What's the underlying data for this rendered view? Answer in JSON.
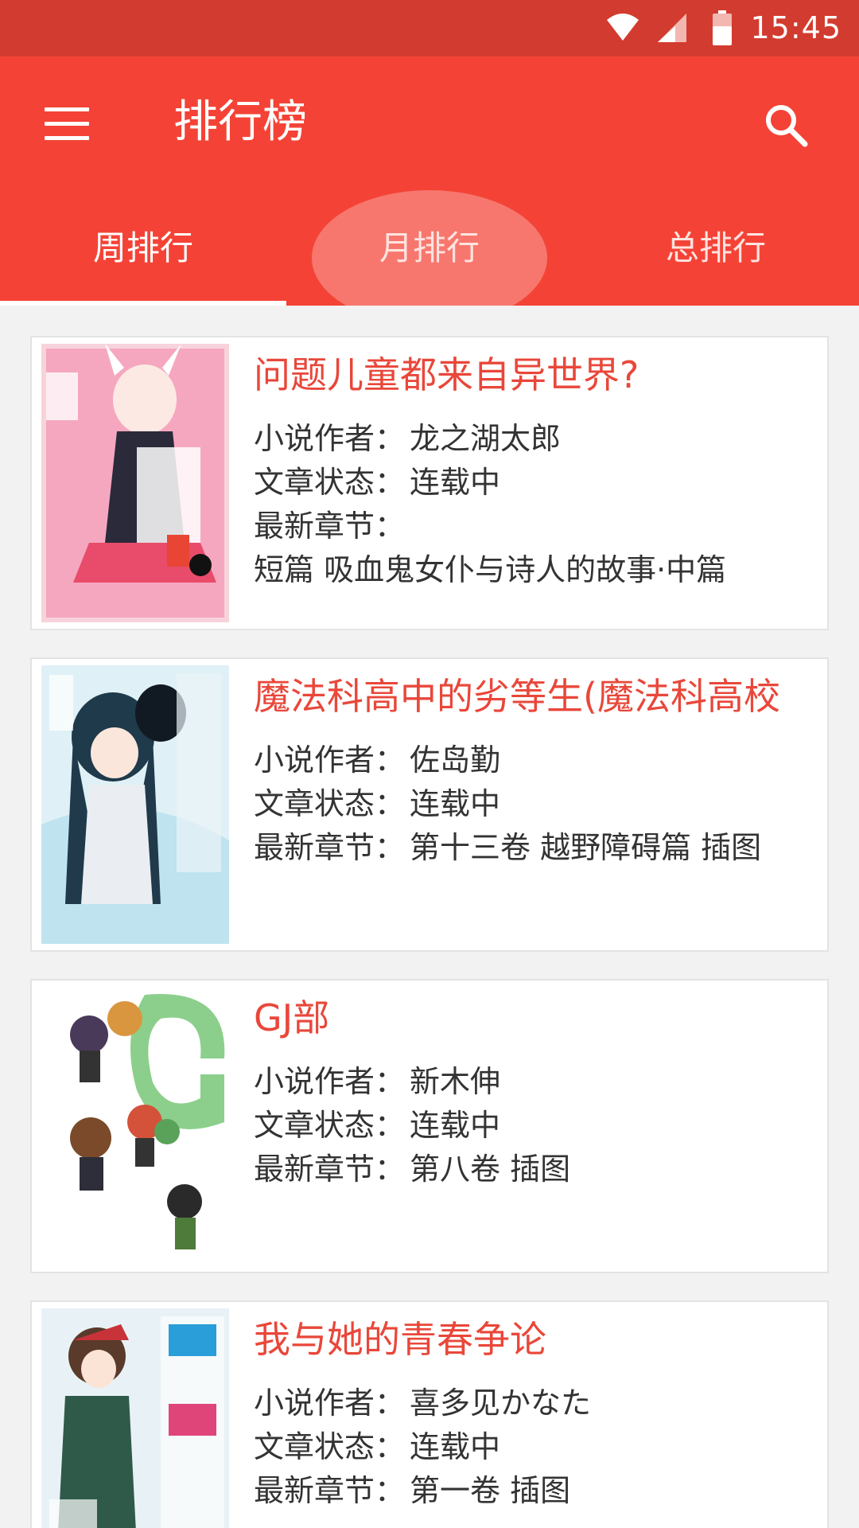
{
  "status_bar": {
    "time": "15:45"
  },
  "app_bar": {
    "title": "排行榜"
  },
  "tabs": [
    {
      "label": "周排行",
      "active": true
    },
    {
      "label": "月排行",
      "active": false
    },
    {
      "label": "总排行",
      "active": false
    }
  ],
  "labels": {
    "author": "小说作者：",
    "status": "文章状态：",
    "latest": "最新章节："
  },
  "books": [
    {
      "title": "问题儿童都来自异世界?",
      "author": "龙之湖太郎",
      "status": "连载中",
      "latest": "",
      "latest_line2": "短篇 吸血鬼女仆与诗人的故事·中篇"
    },
    {
      "title": "魔法科高中的劣等生(魔法科高校",
      "author": "佐岛勤",
      "status": "连载中",
      "latest": "第十三卷 越野障碍篇 插图"
    },
    {
      "title": "GJ部",
      "author": "新木伸",
      "status": "连载中",
      "latest": "第八卷 插图"
    },
    {
      "title": "我与她的青春争论",
      "author": "喜多见かなた",
      "status": "连载中",
      "latest": "第一卷 插图"
    }
  ],
  "colors": {
    "primary": "#f44336",
    "status_bar": "#d23b2f",
    "title_text": "#e9473a"
  }
}
